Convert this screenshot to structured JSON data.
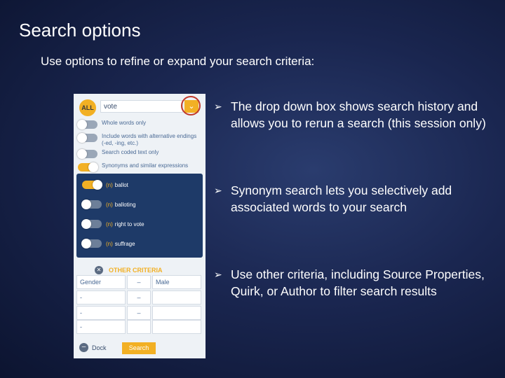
{
  "slide": {
    "title": "Search options",
    "subtitle": "Use options to refine or expand your search criteria:"
  },
  "panel": {
    "all_label": "ALL",
    "search_value": "vote",
    "dropdown_glyph": "⌄",
    "options": [
      {
        "label": "Whole words only",
        "on": false
      },
      {
        "label": "Include words with alternative endings\n(-ed, -ing, etc.)",
        "on": false
      },
      {
        "label": "Search coded text only",
        "on": false
      },
      {
        "label": "Synonyms and similar expressions",
        "on": true
      }
    ],
    "synonyms": [
      {
        "tag": "(n)",
        "word": "ballot",
        "on": true
      },
      {
        "tag": "(n)",
        "word": "balloting",
        "on": false
      },
      {
        "tag": "(n)",
        "word": "right to vote",
        "on": false
      },
      {
        "tag": "(n)",
        "word": "suffrage",
        "on": false
      }
    ],
    "other_criteria": {
      "close_glyph": "✕",
      "label": "OTHER CRITERIA",
      "rows": [
        [
          "Gender",
          "–",
          "Male"
        ],
        [
          "-",
          "–",
          ""
        ],
        [
          "-",
          "–",
          ""
        ],
        [
          "-",
          "",
          ""
        ]
      ]
    },
    "dock_glyph": "–",
    "dock_label": "Dock",
    "search_button": "Search"
  },
  "bullets": [
    {
      "icon": "arrow-bullet-icon",
      "glyph": "➢",
      "text": "The drop down box shows search history and allows you to rerun a search (this session only)"
    },
    {
      "icon": "arrow-bullet-icon",
      "glyph": "➢",
      "text": "Synonym search lets you selectively add associated words to your search"
    },
    {
      "icon": "arrow-bullet-icon",
      "glyph": "➢",
      "text": "Use other criteria, including Source Properties, Quirk, or Author to filter search results"
    }
  ],
  "colors": {
    "accent": "#f2b024",
    "highlight_ring": "#c0392b",
    "synonym_panel": "#1e3a68",
    "background": "#1a2650"
  }
}
